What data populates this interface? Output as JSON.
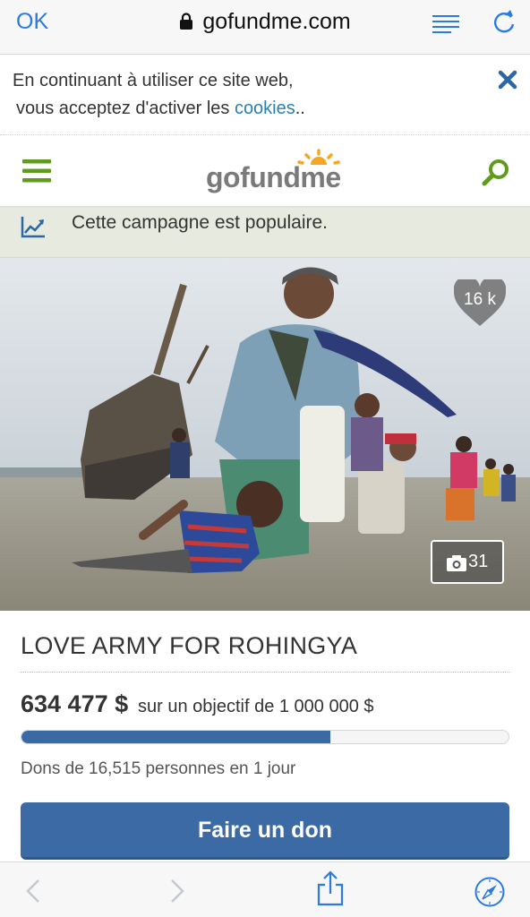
{
  "browser": {
    "ok_label": "OK",
    "domain": "gofundme.com",
    "icons": [
      "lock-icon",
      "reader-icon",
      "reload-icon",
      "back-icon",
      "forward-icon",
      "share-icon",
      "compass-icon"
    ]
  },
  "cookie_banner": {
    "line1": "En continuant à utiliser ce site web,",
    "line2_prefix": "vous acceptez d'activer les ",
    "link_text": "cookies",
    "line2_suffix": "..",
    "close_icon": "close-icon"
  },
  "site_header": {
    "logo_text": "gofundme",
    "menu_icon": "hamburger-menu-icon",
    "search_icon": "search-icon",
    "brand_color": "#5f9c1d"
  },
  "popular_banner": {
    "text": "Cette campagne est populaire.",
    "icon": "trending-chart-icon"
  },
  "hero": {
    "heart_count": "16 k",
    "photo_count": "31"
  },
  "campaign": {
    "title": "LOVE ARMY FOR ROHINGYA",
    "raised": "634 477 $",
    "goal_text": "sur un objectif de 1 000 000 $",
    "progress_fraction": 0.634,
    "donors_text": "Dons de 16,515 personnes en 1 jour",
    "donate_label": "Faire un don",
    "accent_color": "#3b6aa4"
  }
}
